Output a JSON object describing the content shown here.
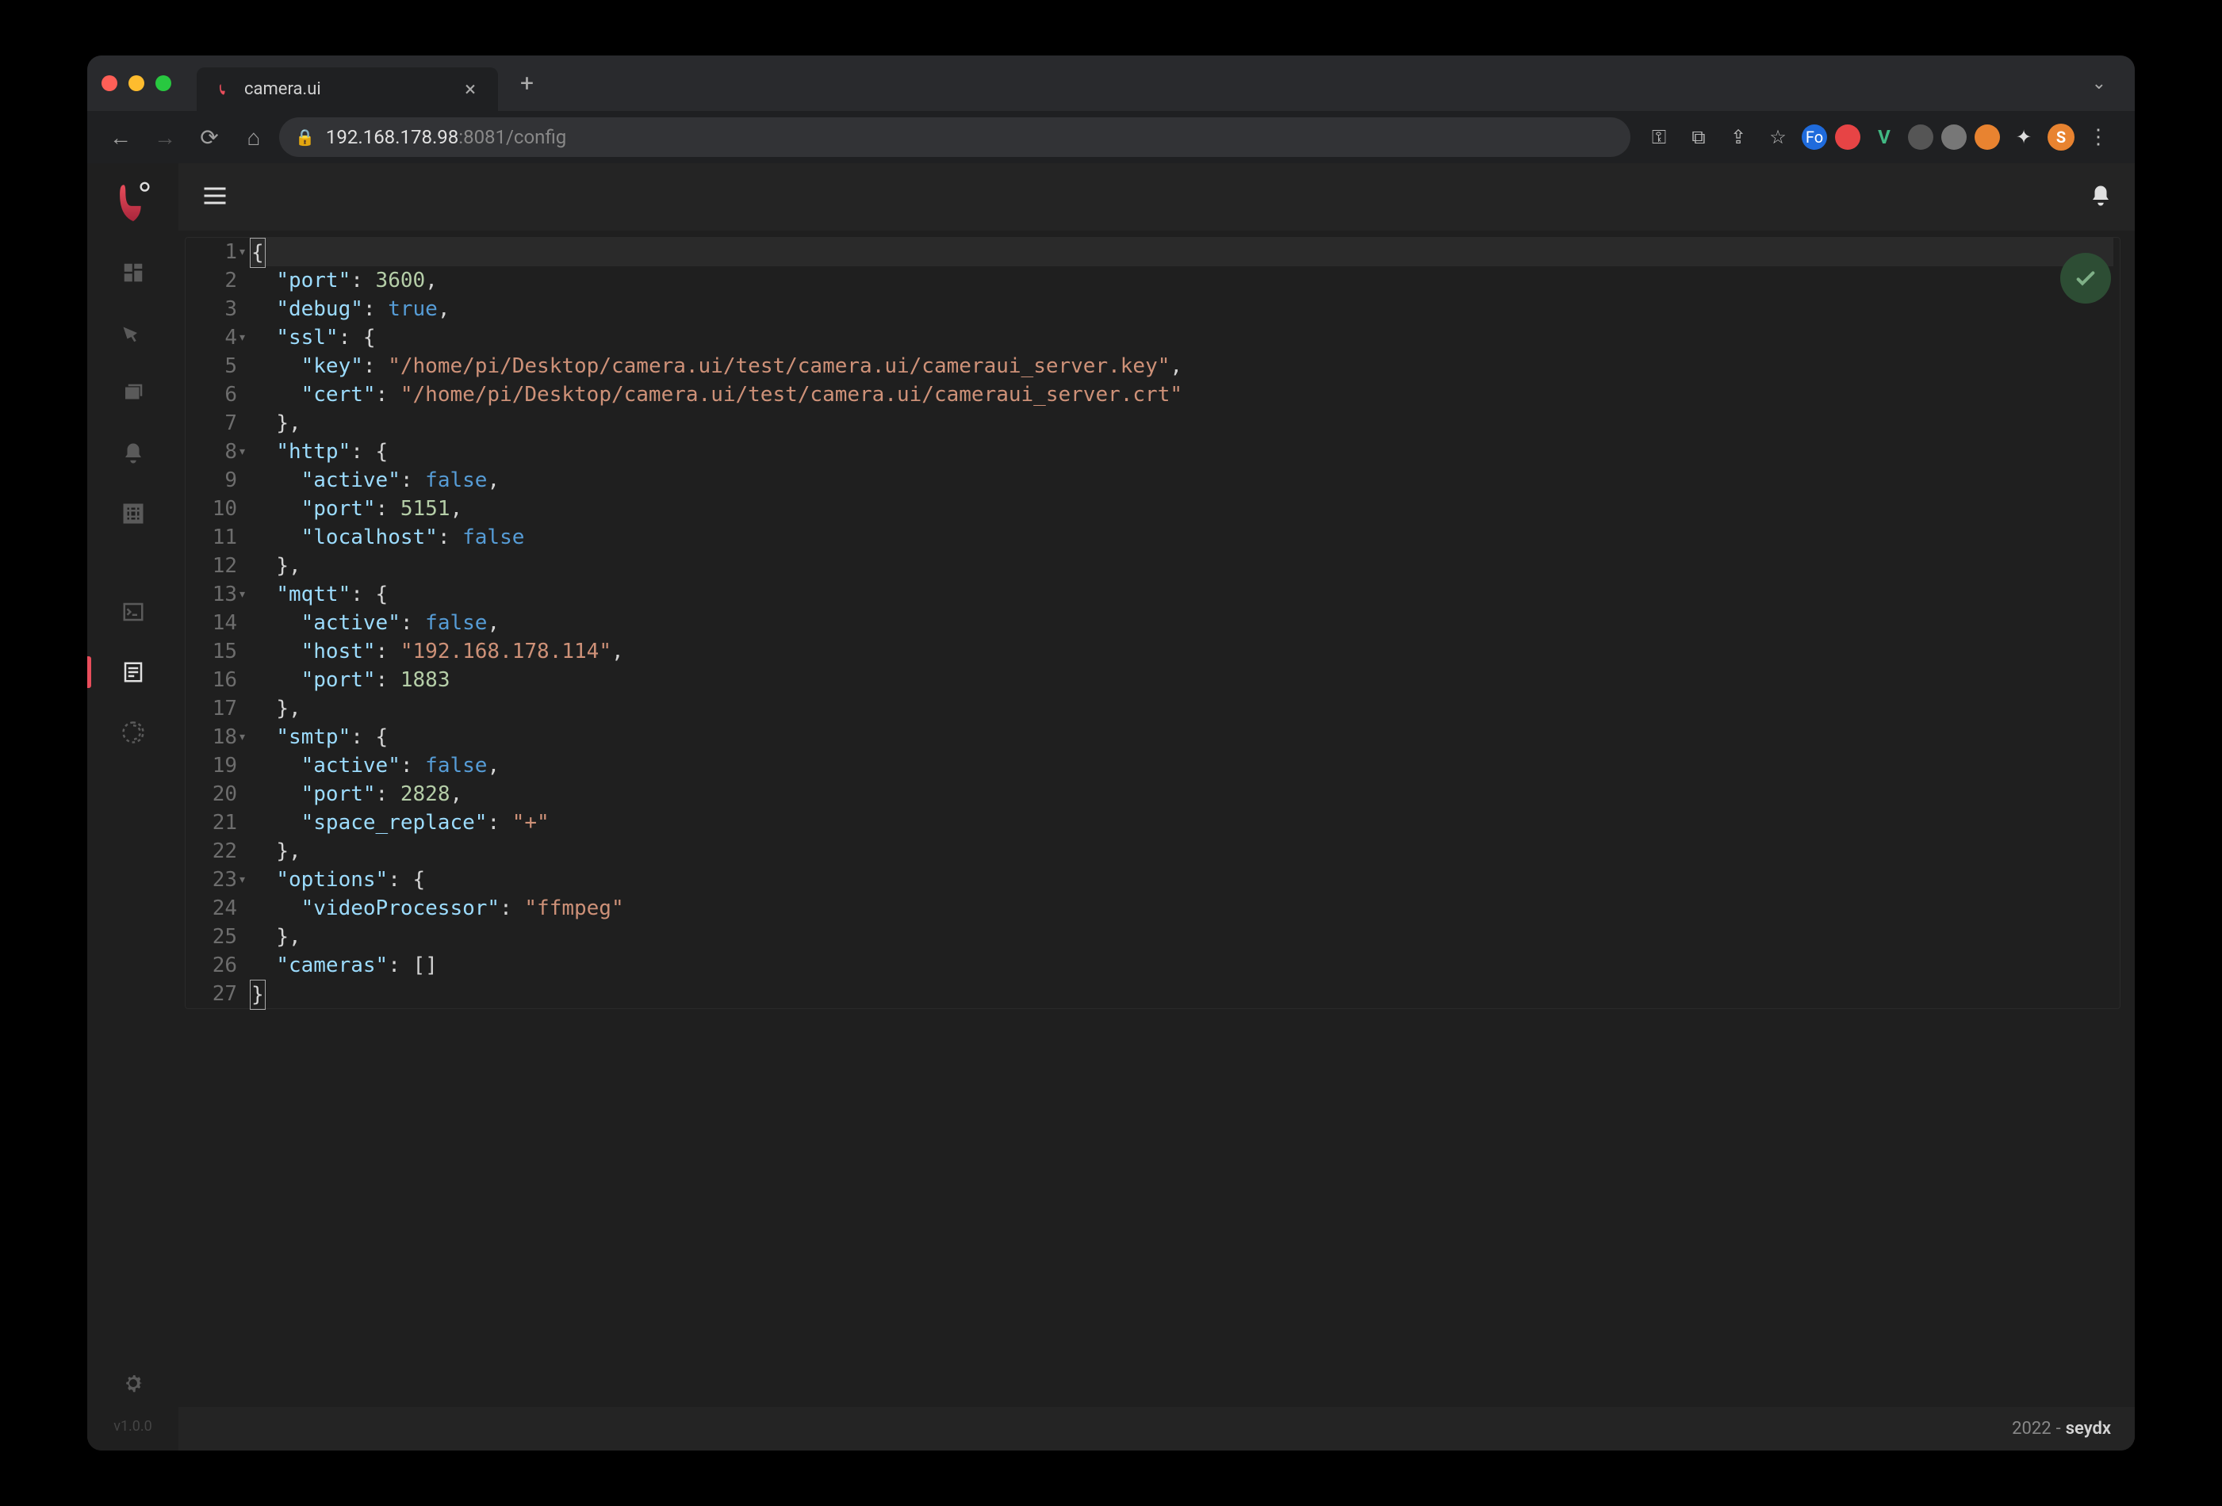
{
  "browser": {
    "tab_title": "camera.ui",
    "url_host": "192.168.178.98",
    "url_port_path": ":8081/config"
  },
  "extensions_avatar_letter": "S",
  "app": {
    "version": "v1.0.0",
    "footer_year": "2022",
    "footer_author": "seydx"
  },
  "editor": {
    "lines": [
      {
        "n": 1,
        "fold": true,
        "tokens": [
          [
            "cursor",
            "{"
          ]
        ]
      },
      {
        "n": 2,
        "fold": false,
        "tokens": [
          [
            "txt",
            "  "
          ],
          [
            "key",
            "\"port\""
          ],
          [
            "punc",
            ": "
          ],
          [
            "num",
            "3600"
          ],
          [
            "punc",
            ","
          ]
        ]
      },
      {
        "n": 3,
        "fold": false,
        "tokens": [
          [
            "txt",
            "  "
          ],
          [
            "key",
            "\"debug\""
          ],
          [
            "punc",
            ": "
          ],
          [
            "bool",
            "true"
          ],
          [
            "punc",
            ","
          ]
        ]
      },
      {
        "n": 4,
        "fold": true,
        "tokens": [
          [
            "txt",
            "  "
          ],
          [
            "key",
            "\"ssl\""
          ],
          [
            "punc",
            ": {"
          ]
        ]
      },
      {
        "n": 5,
        "fold": false,
        "tokens": [
          [
            "txt",
            "    "
          ],
          [
            "key",
            "\"key\""
          ],
          [
            "punc",
            ": "
          ],
          [
            "str",
            "\"/home/pi/Desktop/camera.ui/test/camera.ui/cameraui_server.key\""
          ],
          [
            "punc",
            ","
          ]
        ]
      },
      {
        "n": 6,
        "fold": false,
        "tokens": [
          [
            "txt",
            "    "
          ],
          [
            "key",
            "\"cert\""
          ],
          [
            "punc",
            ": "
          ],
          [
            "str",
            "\"/home/pi/Desktop/camera.ui/test/camera.ui/cameraui_server.crt\""
          ]
        ]
      },
      {
        "n": 7,
        "fold": false,
        "tokens": [
          [
            "txt",
            "  "
          ],
          [
            "punc",
            "},"
          ]
        ]
      },
      {
        "n": 8,
        "fold": true,
        "tokens": [
          [
            "txt",
            "  "
          ],
          [
            "key",
            "\"http\""
          ],
          [
            "punc",
            ": {"
          ]
        ]
      },
      {
        "n": 9,
        "fold": false,
        "tokens": [
          [
            "txt",
            "    "
          ],
          [
            "key",
            "\"active\""
          ],
          [
            "punc",
            ": "
          ],
          [
            "bool",
            "false"
          ],
          [
            "punc",
            ","
          ]
        ]
      },
      {
        "n": 10,
        "fold": false,
        "tokens": [
          [
            "txt",
            "    "
          ],
          [
            "key",
            "\"port\""
          ],
          [
            "punc",
            ": "
          ],
          [
            "num",
            "5151"
          ],
          [
            "punc",
            ","
          ]
        ]
      },
      {
        "n": 11,
        "fold": false,
        "tokens": [
          [
            "txt",
            "    "
          ],
          [
            "key",
            "\"localhost\""
          ],
          [
            "punc",
            ": "
          ],
          [
            "bool",
            "false"
          ]
        ]
      },
      {
        "n": 12,
        "fold": false,
        "tokens": [
          [
            "txt",
            "  "
          ],
          [
            "punc",
            "},"
          ]
        ]
      },
      {
        "n": 13,
        "fold": true,
        "tokens": [
          [
            "txt",
            "  "
          ],
          [
            "key",
            "\"mqtt\""
          ],
          [
            "punc",
            ": {"
          ]
        ]
      },
      {
        "n": 14,
        "fold": false,
        "tokens": [
          [
            "txt",
            "    "
          ],
          [
            "key",
            "\"active\""
          ],
          [
            "punc",
            ": "
          ],
          [
            "bool",
            "false"
          ],
          [
            "punc",
            ","
          ]
        ]
      },
      {
        "n": 15,
        "fold": false,
        "tokens": [
          [
            "txt",
            "    "
          ],
          [
            "key",
            "\"host\""
          ],
          [
            "punc",
            ": "
          ],
          [
            "str",
            "\"192.168.178.114\""
          ],
          [
            "punc",
            ","
          ]
        ]
      },
      {
        "n": 16,
        "fold": false,
        "tokens": [
          [
            "txt",
            "    "
          ],
          [
            "key",
            "\"port\""
          ],
          [
            "punc",
            ": "
          ],
          [
            "num",
            "1883"
          ]
        ]
      },
      {
        "n": 17,
        "fold": false,
        "tokens": [
          [
            "txt",
            "  "
          ],
          [
            "punc",
            "},"
          ]
        ]
      },
      {
        "n": 18,
        "fold": true,
        "tokens": [
          [
            "txt",
            "  "
          ],
          [
            "key",
            "\"smtp\""
          ],
          [
            "punc",
            ": {"
          ]
        ]
      },
      {
        "n": 19,
        "fold": false,
        "tokens": [
          [
            "txt",
            "    "
          ],
          [
            "key",
            "\"active\""
          ],
          [
            "punc",
            ": "
          ],
          [
            "bool",
            "false"
          ],
          [
            "punc",
            ","
          ]
        ]
      },
      {
        "n": 20,
        "fold": false,
        "tokens": [
          [
            "txt",
            "    "
          ],
          [
            "key",
            "\"port\""
          ],
          [
            "punc",
            ": "
          ],
          [
            "num",
            "2828"
          ],
          [
            "punc",
            ","
          ]
        ]
      },
      {
        "n": 21,
        "fold": false,
        "tokens": [
          [
            "txt",
            "    "
          ],
          [
            "key",
            "\"space_replace\""
          ],
          [
            "punc",
            ": "
          ],
          [
            "str",
            "\"+\""
          ]
        ]
      },
      {
        "n": 22,
        "fold": false,
        "tokens": [
          [
            "txt",
            "  "
          ],
          [
            "punc",
            "},"
          ]
        ]
      },
      {
        "n": 23,
        "fold": true,
        "tokens": [
          [
            "txt",
            "  "
          ],
          [
            "key",
            "\"options\""
          ],
          [
            "punc",
            ": {"
          ]
        ]
      },
      {
        "n": 24,
        "fold": false,
        "tokens": [
          [
            "txt",
            "    "
          ],
          [
            "key",
            "\"videoProcessor\""
          ],
          [
            "punc",
            ": "
          ],
          [
            "str",
            "\"ffmpeg\""
          ]
        ]
      },
      {
        "n": 25,
        "fold": false,
        "tokens": [
          [
            "txt",
            "  "
          ],
          [
            "punc",
            "},"
          ]
        ]
      },
      {
        "n": 26,
        "fold": false,
        "tokens": [
          [
            "txt",
            "  "
          ],
          [
            "key",
            "\"cameras\""
          ],
          [
            "punc",
            ": []"
          ]
        ]
      },
      {
        "n": 27,
        "fold": false,
        "tokens": [
          [
            "cursor",
            "}"
          ]
        ]
      }
    ]
  }
}
